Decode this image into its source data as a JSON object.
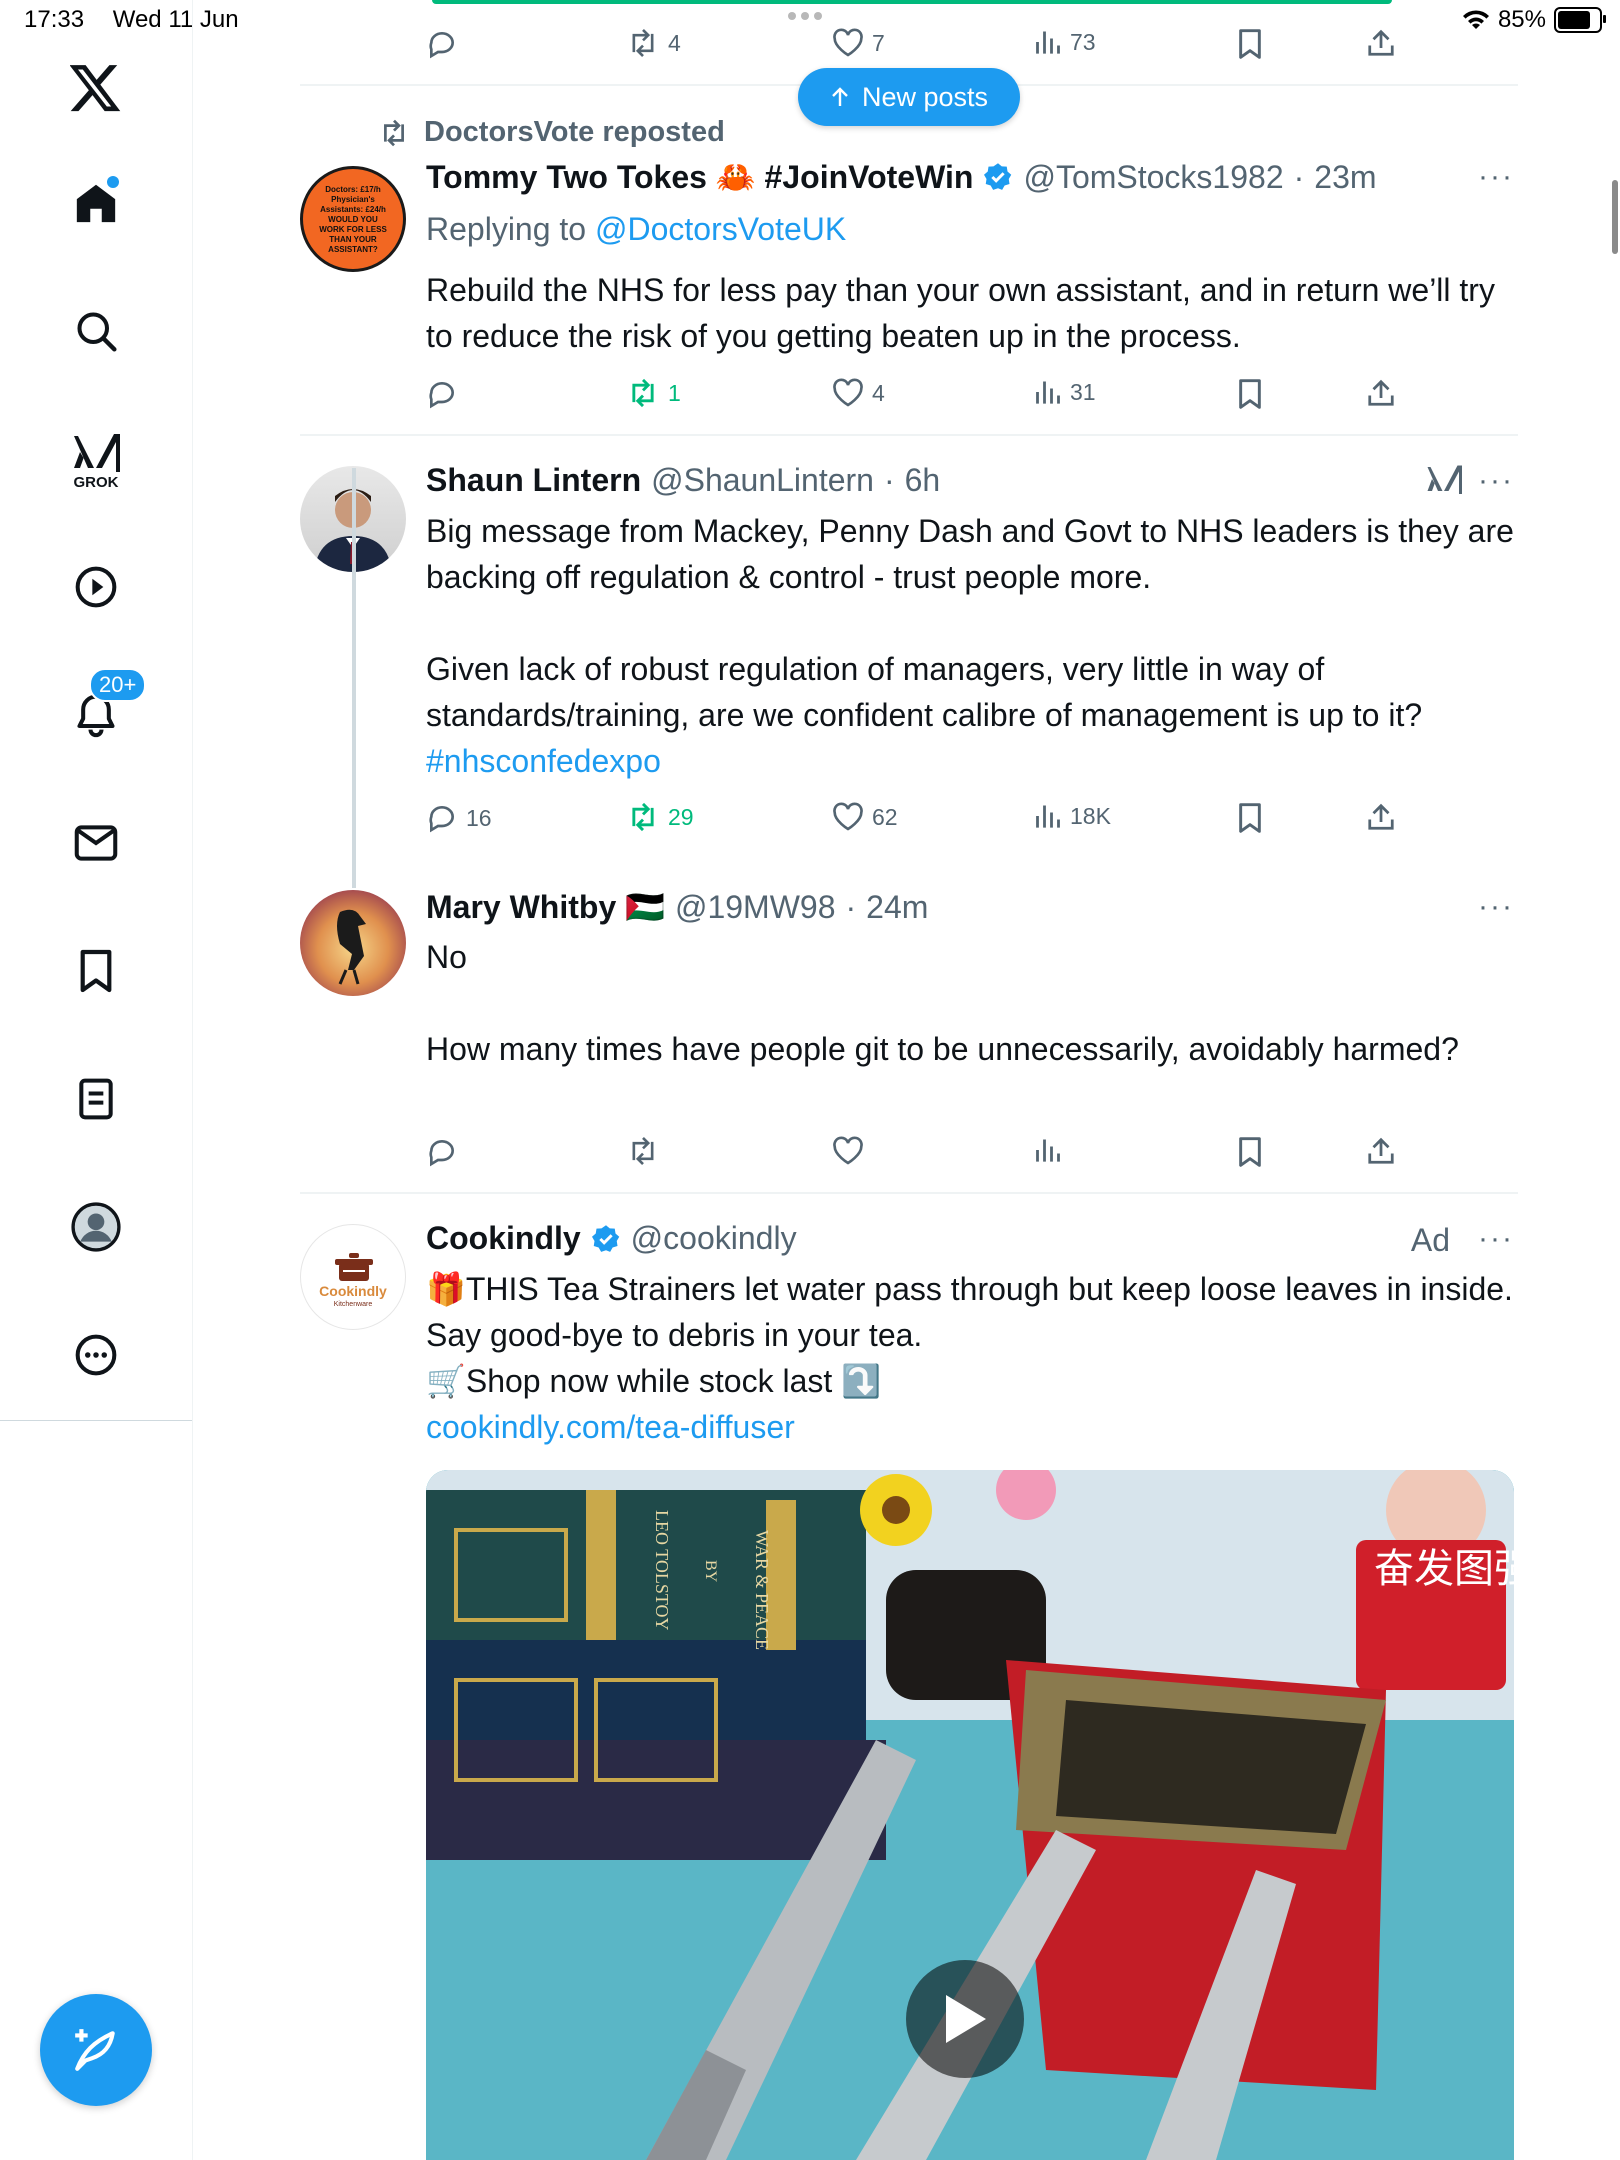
{
  "status_bar": {
    "time": "17:33",
    "date": "Wed 11 Jun",
    "battery": "85%",
    "battery_level": 0.85
  },
  "sidebar": {
    "grok_label": "GROK",
    "notifications_badge": "20+"
  },
  "feed": {
    "new_posts_label": "New posts",
    "top_post_actions": {
      "reposts": "4",
      "likes": "7",
      "views": "73"
    },
    "posts": [
      {
        "reposted_by": "DoctorsVote reposted",
        "avatar_text": "Doctors: £17/h Physician's Assistants: £24/h WOULD YOU WORK FOR LESS THAN YOUR ASSISTANT?",
        "name": "Tommy Two Tokes 🦀 #JoinVoteWin",
        "handle": "@TomStocks1982",
        "time": "23m",
        "replying_prefix": "Replying to ",
        "replying_to": "@DoctorsVoteUK",
        "text": "Rebuild the NHS for less pay than your own assistant, and in return we’ll try to reduce the risk of you getting beaten up in the process.",
        "replies": "",
        "reposts": "1",
        "likes": "4",
        "views": "31"
      },
      {
        "name": "Shaun Lintern",
        "handle": "@ShaunLintern",
        "time": "6h",
        "text": "Big message from Mackey, Penny Dash and Govt to NHS leaders is they are backing off regulation & control - trust people more.\n\nGiven lack of robust regulation of managers, very little in way of standards/training, are we confident calibre of management is up to it?",
        "hashtag": "#nhsconfedexpo",
        "replies": "16",
        "reposts": "29",
        "likes": "62",
        "views": "18K"
      },
      {
        "name": "Mary Whitby 🇵🇸",
        "handle": "@19MW98",
        "time": "24m",
        "text": "No\n\nHow many times have people git to be unnecessarily,  avoidably harmed?"
      },
      {
        "name": "Cookindly",
        "handle": "@cookindly",
        "ad_label": "Ad",
        "avatar_text": "Cookindly",
        "avatar_subtext": "Kitchenware",
        "text": "🎁THIS Tea Strainers let water pass through but keep loose leaves in inside. Say good-bye to debris in your tea.\n🛒Shop now while stock last ⤵️",
        "link": "cookindly.com/tea-diffuser",
        "media_book_titles": [
          "LEO TOLSTOY",
          "WAR & PEACE",
          "BY"
        ],
        "media_sign_text": "奋发图强"
      }
    ]
  },
  "colors": {
    "accent": "#1d9bf0",
    "repost_green": "#00ba7c",
    "secondary_text": "#536471"
  }
}
